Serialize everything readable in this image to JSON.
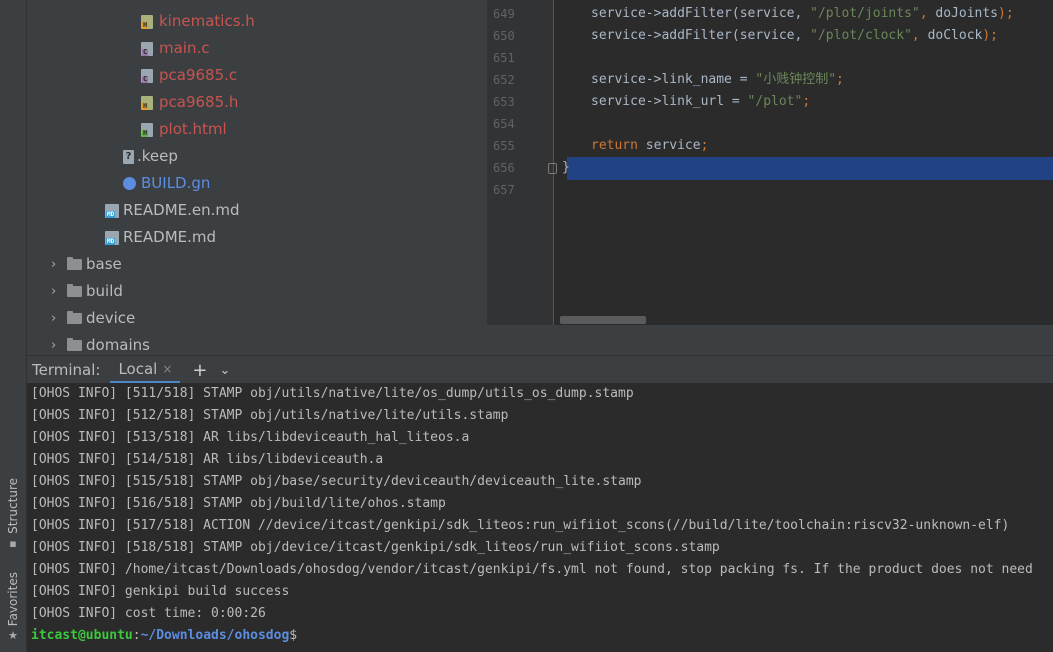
{
  "side_tabs": {
    "structure_label": "Structure",
    "favorites_label": "Favorites",
    "structure_icon": "structure-icon",
    "favorites_icon": "star-icon"
  },
  "project_tree": {
    "items": [
      {
        "label": "kinematics.h",
        "type": "header-file",
        "icon_letter": "H",
        "color": "#c75450"
      },
      {
        "label": "main.c",
        "type": "c-file",
        "icon_letter": "C",
        "color": "#c75450"
      },
      {
        "label": "pca9685.c",
        "type": "c-file",
        "icon_letter": "C",
        "color": "#c75450"
      },
      {
        "label": "pca9685.h",
        "type": "header-file",
        "icon_letter": "H",
        "color": "#c75450"
      },
      {
        "label": "plot.html",
        "type": "html-file",
        "icon_letter": "H",
        "color": "#c75450"
      },
      {
        "label": ".keep",
        "type": "unknown-file",
        "color": "#bbbbbb"
      },
      {
        "label": "BUILD.gn",
        "type": "gn-file",
        "color": "#5c8de0"
      },
      {
        "label": "README.en.md",
        "type": "markdown-file",
        "icon_letter": "MD",
        "color": "#bbbbbb"
      },
      {
        "label": "README.md",
        "type": "markdown-file",
        "icon_letter": "MD",
        "color": "#bbbbbb"
      },
      {
        "label": "base",
        "type": "folder",
        "color": "#bbbbbb"
      },
      {
        "label": "build",
        "type": "folder",
        "color": "#bbbbbb"
      },
      {
        "label": "device",
        "type": "folder",
        "color": "#bbbbbb"
      },
      {
        "label": "domains",
        "type": "folder",
        "color": "#bbbbbb"
      }
    ]
  },
  "editor": {
    "lines": [
      {
        "num": "649",
        "segments": [
          [
            "plain",
            "service->addFilter(service, "
          ],
          [
            "str",
            "\"/plot/joints\""
          ],
          [
            "punc",
            ", "
          ],
          [
            "plain",
            "doJoints"
          ],
          [
            "punc",
            ");"
          ]
        ]
      },
      {
        "num": "650",
        "segments": [
          [
            "plain",
            "service->addFilter(service, "
          ],
          [
            "str",
            "\"/plot/clock\""
          ],
          [
            "punc",
            ", "
          ],
          [
            "plain",
            "doClock"
          ],
          [
            "punc",
            ");"
          ]
        ]
      },
      {
        "num": "651",
        "segments": []
      },
      {
        "num": "652",
        "segments": [
          [
            "plain",
            "service->link_name = "
          ],
          [
            "str",
            "\"小贱钟控制\""
          ],
          [
            "punc",
            ";"
          ]
        ]
      },
      {
        "num": "653",
        "segments": [
          [
            "plain",
            "service->link_url = "
          ],
          [
            "str",
            "\"/plot\""
          ],
          [
            "punc",
            ";"
          ]
        ]
      },
      {
        "num": "654",
        "segments": []
      },
      {
        "num": "655",
        "segments": [
          [
            "kw",
            "return "
          ],
          [
            "plain",
            "service"
          ],
          [
            "punc",
            ";"
          ]
        ]
      },
      {
        "num": "656",
        "segments": [
          [
            "plain",
            "}"
          ]
        ]
      },
      {
        "num": "657",
        "segments": []
      }
    ]
  },
  "terminal": {
    "title": "Terminal:",
    "tab_label": "Local",
    "close_glyph": "×",
    "add_glyph": "+",
    "menu_glyph": "⌄",
    "lines": [
      "[OHOS INFO] [511/518] STAMP obj/utils/native/lite/os_dump/utils_os_dump.stamp",
      "[OHOS INFO] [512/518] STAMP obj/utils/native/lite/utils.stamp",
      "[OHOS INFO] [513/518] AR libs/libdeviceauth_hal_liteos.a",
      "[OHOS INFO] [514/518] AR libs/libdeviceauth.a",
      "[OHOS INFO] [515/518] STAMP obj/base/security/deviceauth/deviceauth_lite.stamp",
      "[OHOS INFO] [516/518] STAMP obj/build/lite/ohos.stamp",
      "[OHOS INFO] [517/518] ACTION //device/itcast/genkipi/sdk_liteos:run_wifiiot_scons(//build/lite/toolchain:riscv32-unknown-elf)",
      "[OHOS INFO] [518/518] STAMP obj/device/itcast/genkipi/sdk_liteos/run_wifiiot_scons.stamp",
      "[OHOS INFO] /home/itcast/Downloads/ohosdog/vendor/itcast/genkipi/fs.yml not found, stop packing fs. If the product does not need",
      "[OHOS INFO] genkipi build success",
      "[OHOS INFO] cost time: 0:00:26"
    ],
    "prompt": {
      "user_host": "itcast@ubuntu",
      "separator": ":",
      "path": "~/Downloads/ohosdog",
      "symbol": "$"
    }
  }
}
